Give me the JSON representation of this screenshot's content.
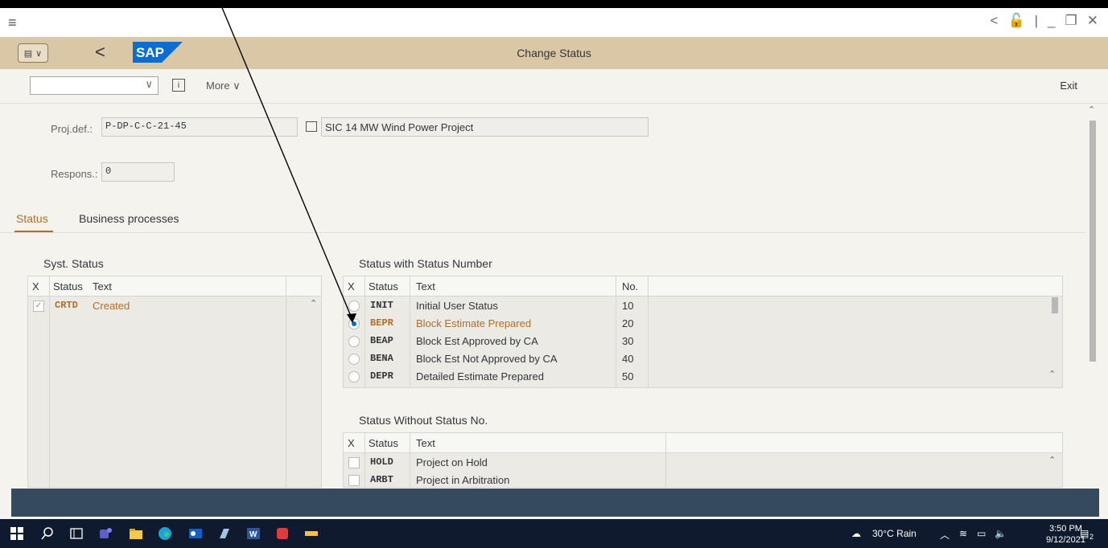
{
  "window": {
    "menu_icon": "hamburger-icon",
    "controls": [
      "<",
      "🔓",
      "|",
      "_",
      "❐",
      "✕"
    ]
  },
  "shell": {
    "title": "Change Status",
    "back_label": "<",
    "logo_text": "SAP"
  },
  "toolbar": {
    "combo_value": "",
    "info_label": "i",
    "more_label": "More ∨",
    "exit_label": "Exit"
  },
  "header": {
    "projdef_label": "Proj.def.:",
    "projdef_value": "P-DP-C-C-21-45",
    "projdef_desc": "SIC 14 MW Wind Power Project",
    "respons_label": "Respons.:",
    "respons_value": "0"
  },
  "tabs": [
    {
      "label": "Status",
      "active": true
    },
    {
      "label": "Business processes",
      "active": false
    }
  ],
  "syst_status": {
    "title": "Syst. Status",
    "columns": [
      "X",
      "Status",
      "Text"
    ],
    "rows": [
      {
        "checked": true,
        "status": "CRTD",
        "text": "Created"
      }
    ]
  },
  "status_with_no": {
    "title": "Status with Status Number",
    "columns": [
      "X",
      "Status",
      "Text",
      "No."
    ],
    "rows": [
      {
        "selected": false,
        "status": "INIT",
        "text": "Initial User Status",
        "no": "10"
      },
      {
        "selected": true,
        "status": "BEPR",
        "text": "Block Estimate Prepared",
        "no": "20"
      },
      {
        "selected": false,
        "status": "BEAP",
        "text": "Block Est Approved by CA",
        "no": "30"
      },
      {
        "selected": false,
        "status": "BENA",
        "text": "Block Est Not Approved by CA",
        "no": "40"
      },
      {
        "selected": false,
        "status": "DEPR",
        "text": "Detailed Estimate Prepared",
        "no": "50"
      }
    ]
  },
  "status_without_no": {
    "title": "Status Without Status No.",
    "columns": [
      "X",
      "Status",
      "Text"
    ],
    "rows": [
      {
        "checked": false,
        "status": "HOLD",
        "text": "Project on Hold"
      },
      {
        "checked": false,
        "status": "ARBT",
        "text": "Project in Arbitration"
      }
    ]
  },
  "taskbar": {
    "weather": "30°C Rain",
    "time": "3:50 PM",
    "date": "9/12/2021",
    "notif_count": "2"
  },
  "colors": {
    "shell": "#d9c7a6",
    "accent": "#b06e2a",
    "footer": "#354a5f",
    "taskbar": "#0f1a2e"
  }
}
